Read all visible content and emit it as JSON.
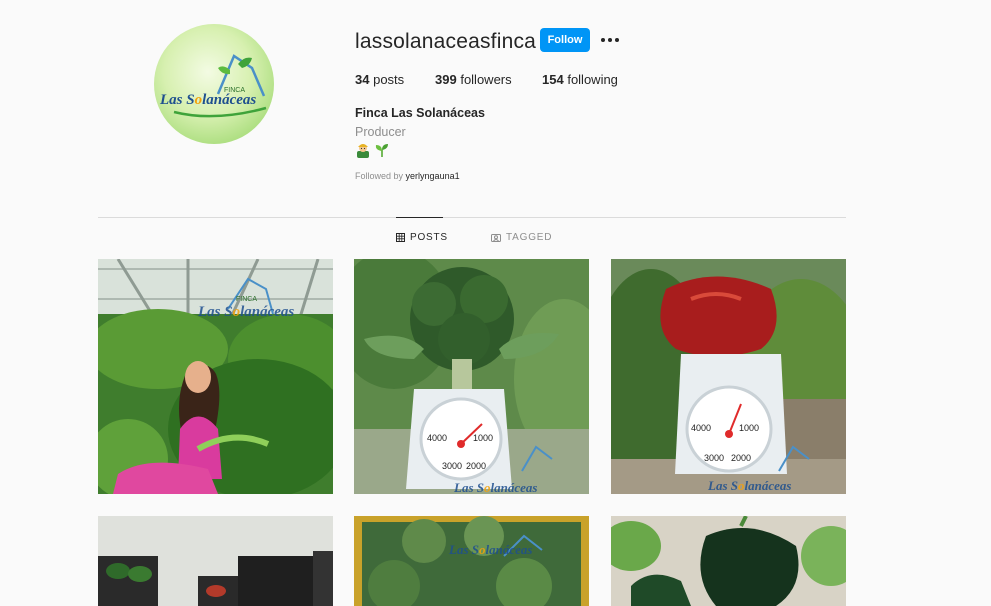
{
  "profile": {
    "username": "lassolanaceasfinca",
    "follow_label": "Follow",
    "more_icon": "more-options-icon",
    "stats": {
      "posts_count": "34",
      "posts_label": "posts",
      "followers_count": "399",
      "followers_label": "followers",
      "following_count": "154",
      "following_label": "following"
    },
    "full_name": "Finca Las Solanáceas",
    "category": "Producer",
    "bio_emojis": [
      "farmer-emoji",
      "seedling-emoji"
    ],
    "followed_by_prefix": "Followed by",
    "followed_by_user": "yerlyngauna1",
    "avatar_logo": {
      "top_word": "FINCA",
      "brand_prefix": "Las S",
      "brand_suffix": "lanáceas"
    }
  },
  "tabs": [
    {
      "label": "POSTS",
      "icon": "grid-icon",
      "active": true
    },
    {
      "label": "TAGGED",
      "icon": "tagged-icon",
      "active": false
    }
  ],
  "posts": [
    {
      "subject": "girl-with-carrot-harvest",
      "watermark": {
        "top": "FINCA",
        "prefix": "Las S",
        "suffix": "lanáceas"
      }
    },
    {
      "subject": "broccoli-on-scale",
      "scale": {
        "mark_left": "4000",
        "mark_right": "1000",
        "mark_bl": "3000",
        "mark_br": "2000"
      },
      "watermark": {
        "prefix": "Las S",
        "suffix": "lanáceas"
      }
    },
    {
      "subject": "red-pepper-on-scale",
      "scale": {
        "mark_left": "4000",
        "mark_right": "1000",
        "mark_bl": "3000",
        "mark_br": "2000"
      },
      "watermark": {
        "prefix": "Las S",
        "suffix": "lanáceas"
      }
    },
    {
      "subject": "crates-of-peppers"
    },
    {
      "subject": "broccoli-crates",
      "watermark": {
        "prefix": "Las S",
        "suffix": "lanáceas"
      }
    },
    {
      "subject": "green-peppers-on-plant"
    }
  ],
  "colors": {
    "accent_blue": "#0095f6",
    "text_primary": "#262626",
    "text_secondary": "#8e8e8e",
    "background": "#fafafa",
    "divider": "#dbdbdb"
  }
}
